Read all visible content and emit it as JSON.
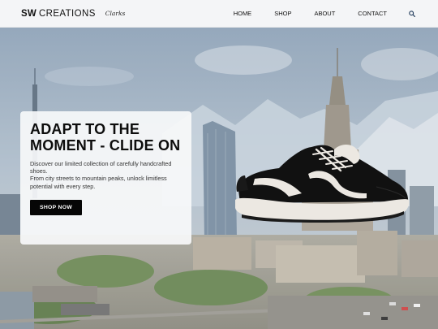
{
  "brand": {
    "name_bold": "SW",
    "name_rest": "CREATIONS",
    "partner": "Clarks"
  },
  "nav": {
    "items": [
      {
        "label": "HOME"
      },
      {
        "label": "SHOP"
      },
      {
        "label": "ABOUT"
      },
      {
        "label": "CONTACT"
      }
    ],
    "search_icon": "search-icon"
  },
  "hero": {
    "title": "ADAPT TO THE MOMENT - CLIDE ON",
    "description_line1": "Discover our limited collection of carefully handcrafted shoes.",
    "description_line2": "From city streets to mountain peaks, unlock limitless potential with every step.",
    "cta_label": "SHOP NOW"
  },
  "colors": {
    "nav_bg": "#f4f5f7",
    "cta_bg": "#060606",
    "sky": "#9fb2c6",
    "shoe_black": "#111111",
    "shoe_sole": "#ece8e2"
  }
}
